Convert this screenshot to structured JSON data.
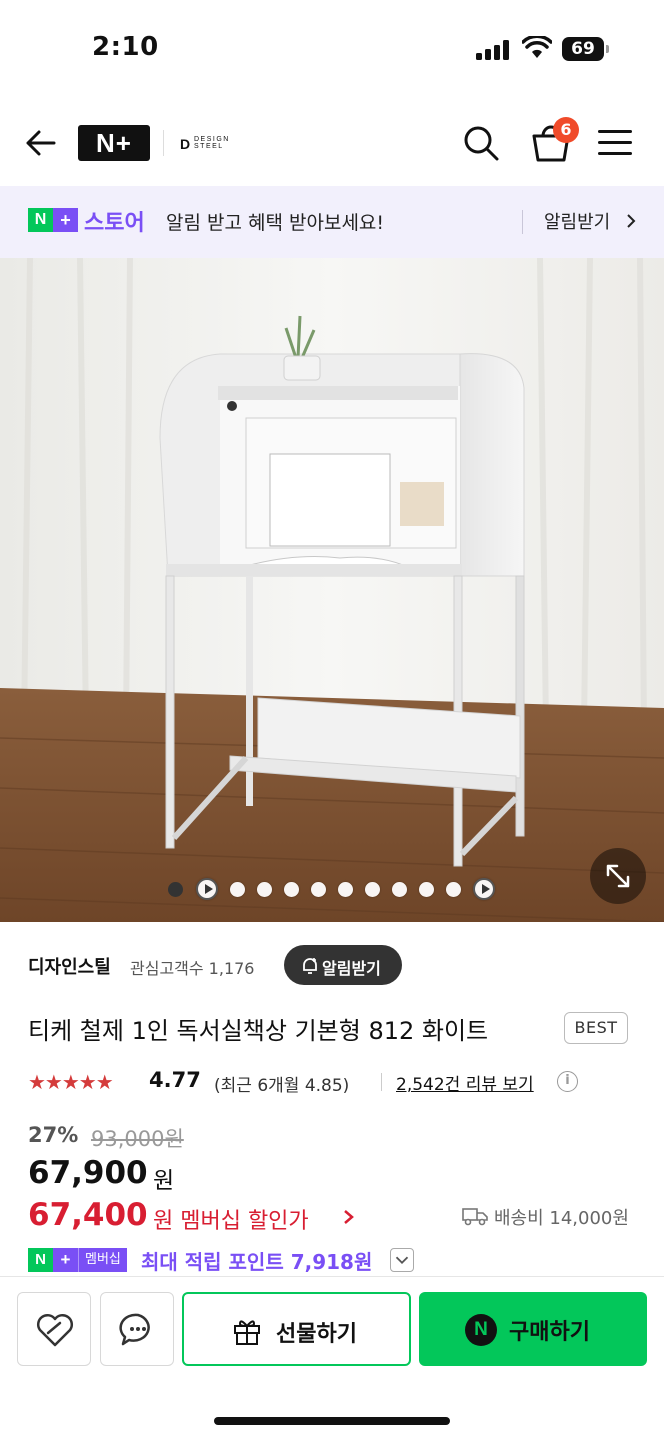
{
  "status_bar": {
    "time": "2:10",
    "battery": "69"
  },
  "header": {
    "logo_text": "N+",
    "brand_logo_mark": "D",
    "brand_logo_line1": "DESIGN",
    "brand_logo_line2": "STEEL",
    "cart_count": "6",
    "icons": [
      "back-arrow-icon",
      "search-icon",
      "cart-icon",
      "hamburger-menu-icon"
    ]
  },
  "banner": {
    "badge_n": "N",
    "badge_plus": "+",
    "store": "스토어",
    "message": "알림 받고 혜택 받아보세요!",
    "action": "알림받기"
  },
  "gallery": {
    "expand_icon": "expand-icon",
    "indicators": [
      {
        "type": "dot",
        "active": true
      },
      {
        "type": "play",
        "active": false
      },
      {
        "type": "dot",
        "active": false
      },
      {
        "type": "dot",
        "active": false
      },
      {
        "type": "dot",
        "active": false
      },
      {
        "type": "dot",
        "active": false
      },
      {
        "type": "dot",
        "active": false
      },
      {
        "type": "dot",
        "active": false
      },
      {
        "type": "dot",
        "active": false
      },
      {
        "type": "dot",
        "active": false
      },
      {
        "type": "dot",
        "active": false
      },
      {
        "type": "play",
        "active": false
      }
    ]
  },
  "seller": {
    "name": "디자인스틸",
    "interest_label": "관심고객수 1,176",
    "alarm_button": "알림받기"
  },
  "product": {
    "title": "티케 철제 1인 독서실책상 기본형 812 화이트",
    "badge": "BEST",
    "rating_stars": "★★★★★",
    "rating": "4.77",
    "recent_rating": "(최근 6개월 4.85)",
    "review_link": "2,542건 리뷰 보기",
    "info_icon": "i"
  },
  "price": {
    "discount_rate": "27%",
    "original": "93,000원",
    "sale": "67,900",
    "sale_unit": "원",
    "member": "67,400",
    "member_label": "원 멤버십 할인가",
    "shipping": "배송비 14,000원"
  },
  "points": {
    "badge_n": "N",
    "badge_plus": "+",
    "badge_member": "멤버십",
    "text": "최대 적립 포인트 7,918원"
  },
  "bottom_bar": {
    "gift_label": "선물하기",
    "buy_logo": "N",
    "buy_label": "구매하기"
  },
  "colors": {
    "naver_green": "#03c75a",
    "plus_purple": "#7a4ff5",
    "price_red": "#d81e32",
    "star_red": "#d43b3b"
  }
}
